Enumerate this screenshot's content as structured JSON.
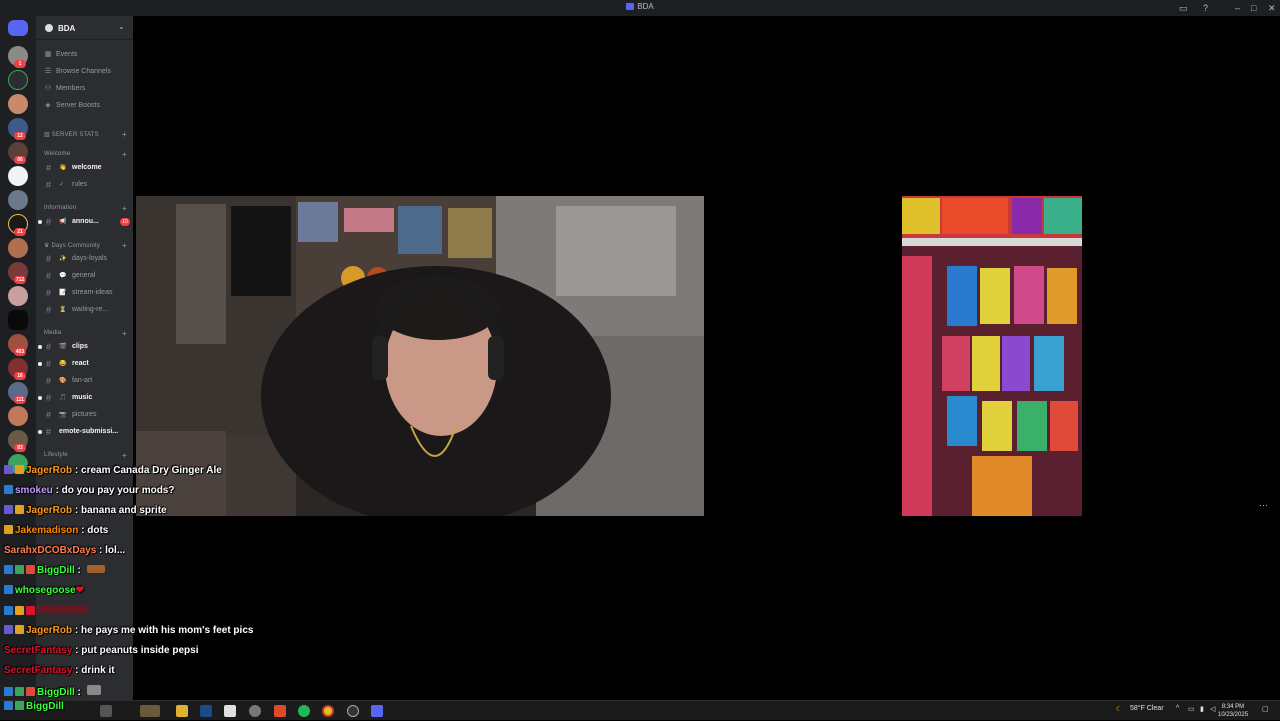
{
  "window": {
    "title": "BDA"
  },
  "server": {
    "name": "BDA",
    "menu": [
      "Events",
      "Browse Channels",
      "Members",
      "Server Boosts"
    ]
  },
  "categories": {
    "server_stats": "SERVER STATS",
    "welcome": "Welcome",
    "information": "Information",
    "days_community": "Days Community",
    "media": "Media",
    "lifestyle": "Lifestyle"
  },
  "channels": [
    {
      "name": "welcome",
      "emoji": "👋",
      "unread": true
    },
    {
      "name": "rules",
      "emoji": "✓",
      "unread": false
    },
    {
      "name": "annou...",
      "emoji": "📢",
      "unread": true,
      "mentions": "10"
    },
    {
      "name": "days-loyals",
      "emoji": "✨",
      "unread": false
    },
    {
      "name": "general",
      "emoji": "💬",
      "unread": false
    },
    {
      "name": "stream-ideas",
      "emoji": "📝",
      "unread": false
    },
    {
      "name": "waiting-re...",
      "emoji": "⏳",
      "unread": false
    },
    {
      "name": "clips",
      "emoji": "🎬",
      "unread": true
    },
    {
      "name": "react",
      "emoji": "😂",
      "unread": true
    },
    {
      "name": "fan-art",
      "emoji": "🎨",
      "unread": false
    },
    {
      "name": "music",
      "emoji": "🎵",
      "unread": true
    },
    {
      "name": "pictures",
      "emoji": "📷",
      "unread": false
    },
    {
      "name": "emote-submissi...",
      "emoji": "",
      "unread": true
    }
  ],
  "server_badges": [
    "1",
    "12",
    "86",
    "21",
    "712",
    "403",
    "16",
    "111",
    "83"
  ],
  "chat": [
    {
      "user": "JagerRob",
      "color": "#ff9a1f",
      "message": " : cream Canada Dry Ginger Ale"
    },
    {
      "user": "smokeu",
      "color": "#c59bff",
      "message": " : do you pay your mods?"
    },
    {
      "user": "JagerRob",
      "color": "#ff9a1f",
      "message": " : banana and sprite"
    },
    {
      "user": "Jakemadison",
      "color": "#ff8a00",
      "message": " : dots"
    },
    {
      "user": "SarahxDCOBxDays",
      "color": "#ff7f50",
      "message": " : lol..."
    },
    {
      "user": "BiggDill",
      "color": "#3cff3c",
      "message": " :"
    },
    {
      "user": "whosegoose",
      "color": "#3cff3c",
      "message": ""
    },
    {
      "user": "JagerRob",
      "color": "#ff9a1f",
      "message": " : he pays me with his mom's feet pics"
    },
    {
      "user": "SecretFantasy",
      "color": "#e0102a",
      "message": " : put peanuts inside pepsi"
    },
    {
      "user": "SecretFantasy",
      "color": "#e0102a",
      "message": " : drink it"
    },
    {
      "user": "BiggDill",
      "color": "#3cff3c",
      "message": " :"
    },
    {
      "user": "BiggDill",
      "color": "#3cff3c",
      "message": ""
    }
  ],
  "tray": {
    "weather": "58°F  Clear",
    "time": "8:34 PM",
    "date": "10/23/2025"
  },
  "icons": {
    "discord": "discord-icon",
    "more": "more-options-icon",
    "minimize": "minimize-icon",
    "maximize": "maximize-icon",
    "close": "close-icon"
  }
}
